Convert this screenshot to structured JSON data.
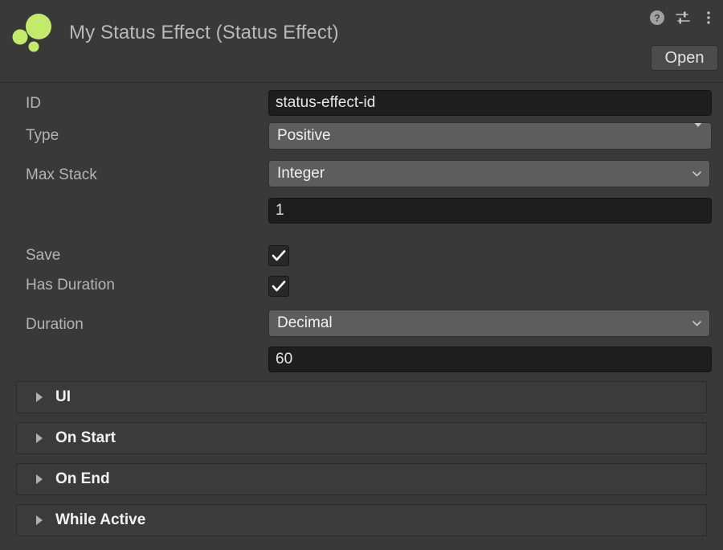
{
  "header": {
    "title": "My Status Effect (Status Effect)",
    "icon_name": "status-effect-asset-icon",
    "icon_color": "#c2eb6b",
    "help_icon": "help-icon",
    "preset_icon": "preset-sliders-icon",
    "menu_icon": "kebab-menu-icon",
    "open_label": "Open"
  },
  "fields": {
    "id": {
      "label": "ID",
      "value": "status-effect-id",
      "placeholder": ""
    },
    "type": {
      "label": "Type",
      "value": "Positive",
      "arrow": "triangle-down-icon"
    },
    "max_stack": {
      "label": "Max Stack",
      "mode": "Integer",
      "value": "1",
      "arrow": "chevron-down-icon"
    },
    "save": {
      "label": "Save",
      "checked": true
    },
    "has_duration": {
      "label": "Has Duration",
      "checked": true
    },
    "duration": {
      "label": "Duration",
      "mode": "Decimal",
      "value": "60",
      "arrow": "chevron-down-icon"
    }
  },
  "foldouts": [
    {
      "label": "UI",
      "expanded": false
    },
    {
      "label": "On Start",
      "expanded": false
    },
    {
      "label": "On End",
      "expanded": false
    },
    {
      "label": "While Active",
      "expanded": false
    }
  ],
  "colors": {
    "background": "#393939",
    "input_background": "#1e1e1e",
    "dropdown_background": "#5d5d5d",
    "foldout_background": "#3b3b3b",
    "accent_green": "#c2eb6b",
    "label_text": "#b4b4b4"
  }
}
